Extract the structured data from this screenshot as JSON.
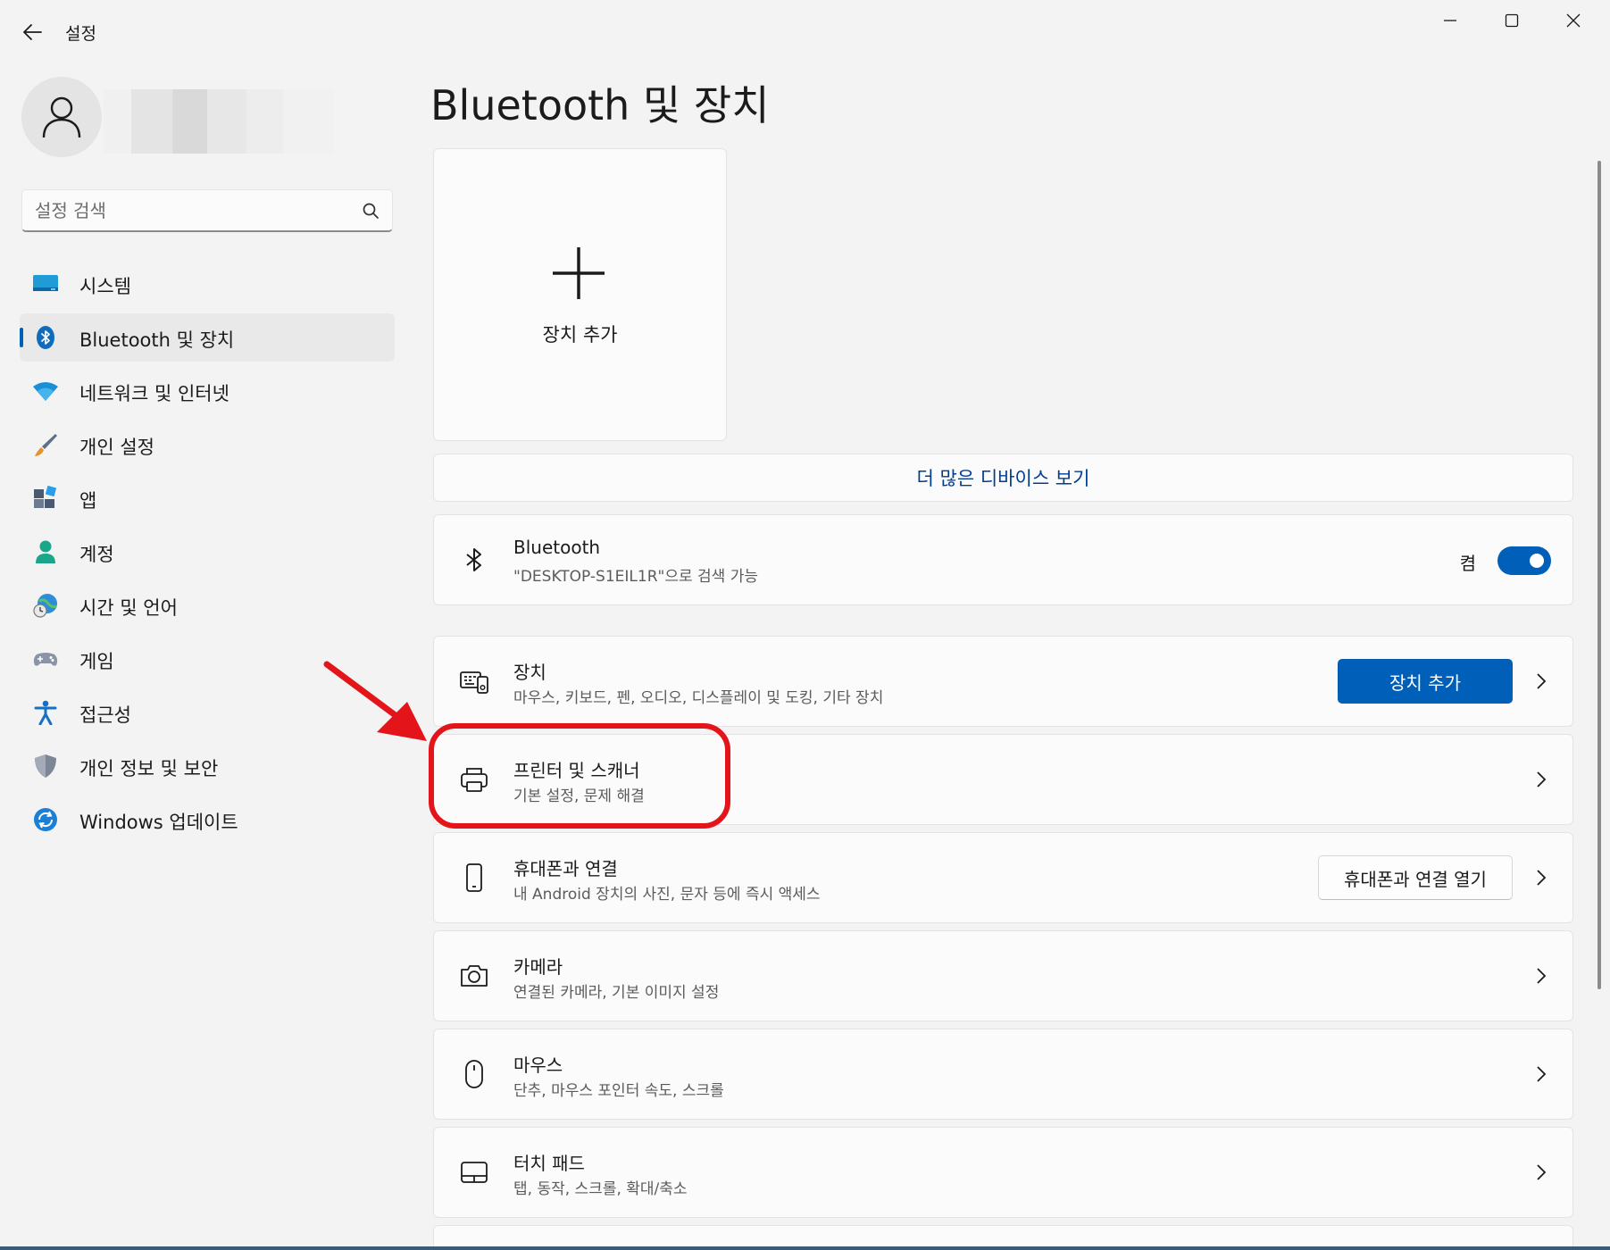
{
  "window": {
    "title": "설정"
  },
  "sidebar": {
    "search_placeholder": "설정 검색",
    "items": [
      {
        "label": "시스템",
        "icon": "display-icon"
      },
      {
        "label": "Bluetooth 및 장치",
        "icon": "bluetooth-icon",
        "active": true
      },
      {
        "label": "네트워크 및 인터넷",
        "icon": "wifi-icon"
      },
      {
        "label": "개인 설정",
        "icon": "paintbrush-icon"
      },
      {
        "label": "앱",
        "icon": "apps-icon"
      },
      {
        "label": "계정",
        "icon": "person-icon"
      },
      {
        "label": "시간 및 언어",
        "icon": "clock-globe-icon"
      },
      {
        "label": "게임",
        "icon": "gamepad-icon"
      },
      {
        "label": "접근성",
        "icon": "accessibility-icon"
      },
      {
        "label": "개인 정보 및 보안",
        "icon": "shield-icon"
      },
      {
        "label": "Windows 업데이트",
        "icon": "update-icon"
      }
    ]
  },
  "main": {
    "title": "Bluetooth 및 장치",
    "add_tile_label": "장치 추가",
    "more_devices_label": "더 많은 디바이스 보기",
    "bluetooth": {
      "title": "Bluetooth",
      "subtitle": "\"DESKTOP-S1EIL1R\"으로 검색 가능",
      "toggle_label": "켬",
      "toggle_on": true
    },
    "cards": [
      {
        "title": "장치",
        "subtitle": "마우스, 키보드, 펜, 오디오, 디스플레이 및 도킹, 기타 장치",
        "button": "장치 추가",
        "icon": "devices-icon"
      },
      {
        "title": "프린터 및 스캐너",
        "subtitle": "기본 설정, 문제 해결",
        "icon": "printer-icon"
      },
      {
        "title": "휴대폰과 연결",
        "subtitle": "내 Android 장치의 사진, 문자 등에 즉시 액세스",
        "button": "휴대폰과 연결 열기",
        "icon": "phone-icon"
      },
      {
        "title": "카메라",
        "subtitle": "연결된 카메라, 기본 이미지 설정",
        "icon": "camera-icon"
      },
      {
        "title": "마우스",
        "subtitle": "단추, 마우스 포인터 속도, 스크롤",
        "icon": "mouse-icon"
      },
      {
        "title": "터치 패드",
        "subtitle": "탭, 동작, 스크롤, 확대/축소",
        "icon": "touchpad-icon"
      }
    ]
  },
  "colors": {
    "accent": "#005fb8",
    "link": "#003e92",
    "annotation": "#e3151b"
  }
}
